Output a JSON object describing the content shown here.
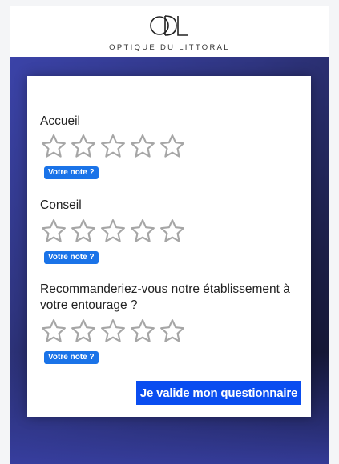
{
  "header": {
    "logo_monogram": "ODL",
    "brand_name": "OPTIQUE DU LITTORAL"
  },
  "survey": {
    "questions": [
      {
        "label": "Accueil",
        "badge": "Votre note ?",
        "rating": 0,
        "max": 5
      },
      {
        "label": "Conseil",
        "badge": "Votre note ?",
        "rating": 0,
        "max": 5
      },
      {
        "label": "Recommanderiez-vous notre établissement à votre entourage ?",
        "badge": "Votre note ?",
        "rating": 0,
        "max": 5
      }
    ],
    "submit_label": "Je valide mon questionnaire"
  },
  "colors": {
    "badge": "#1a73e8",
    "submit": "#0a4df0",
    "star_outline": "#a6a6a6",
    "hero_top": "#3b43a8",
    "hero_dark": "#0e1024"
  },
  "icons": {
    "star": "star-outline-icon",
    "logo": "odl-logo-icon"
  }
}
